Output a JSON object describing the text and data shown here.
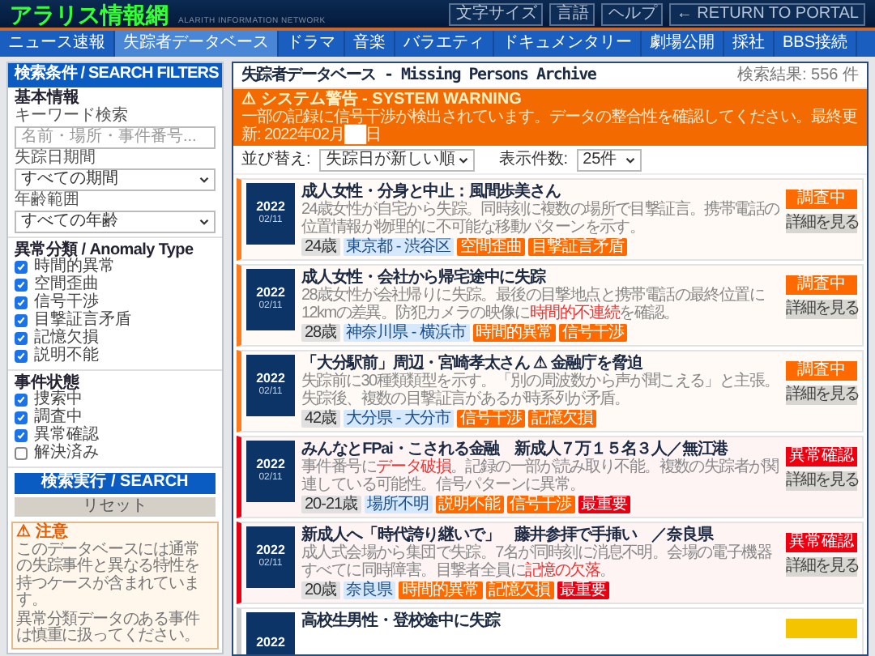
{
  "header": {
    "logo": "アラリス情報網",
    "subtitle": "ALARITH INFORMATION NETWORK",
    "buttons": [
      "文字サイズ",
      "言語",
      "ヘルプ",
      "← RETURN TO PORTAL"
    ]
  },
  "nav": [
    {
      "label": "ニュース速報",
      "selected": false
    },
    {
      "label": "失踪者データベース",
      "selected": true
    },
    {
      "label": "ドラマ",
      "selected": false
    },
    {
      "label": "音楽",
      "selected": false
    },
    {
      "label": "バラエティ",
      "selected": false
    },
    {
      "label": "ドキュメンタリー",
      "selected": false
    },
    {
      "label": "劇場公開",
      "selected": false
    },
    {
      "label": "採社",
      "selected": false
    },
    {
      "label": "BBS接続",
      "selected": false
    }
  ],
  "sidebar": {
    "title": "検索条件 / SEARCH FILTERS",
    "basic_title": "基本情報",
    "keyword_label": "キーワード検索",
    "keyword_placeholder": "名前・場所・事件番号...",
    "period_label": "失踪日期間",
    "period_value": "すべての期間",
    "age_label": "年齢範囲",
    "age_value": "すべての年齢",
    "anomaly_title": "異常分類 / Anomaly Type",
    "anomaly_types": [
      {
        "label": "時間的異常",
        "checked": true
      },
      {
        "label": "空間歪曲",
        "checked": true
      },
      {
        "label": "信号干渉",
        "checked": true
      },
      {
        "label": "目撃証言矛盾",
        "checked": true
      },
      {
        "label": "記憶欠損",
        "checked": true
      },
      {
        "label": "説明不能",
        "checked": true
      }
    ],
    "status_title": "事件状態",
    "statuses": [
      {
        "label": "捜索中",
        "checked": true
      },
      {
        "label": "調査中",
        "checked": true
      },
      {
        "label": "異常確認",
        "checked": true
      },
      {
        "label": "解決済み",
        "checked": false
      }
    ],
    "search_button": "検索実行 / SEARCH",
    "reset_button": "リセット",
    "notice": {
      "title": "⚠ 注意",
      "lines": [
        "このデータベースには通常の失踪事件と異なる特性を持つケースが含まれています。",
        "異常分類データのある事件は慎重に扱ってください。"
      ]
    }
  },
  "main": {
    "title": "失踪者データベース - Missing Persons Archive",
    "result_count": "検索結果: 556 件",
    "warning": {
      "title": "⚠ システム警告 - SYSTEM WARNING",
      "text": "一部の記録に信号干渉が検出されています。データの整合性を確認してください。最終更新: 2022年02月",
      "redacted": "██",
      "suffix": "日"
    },
    "sort_label": "並び替え:",
    "sort_value": "失踪日が新しい順",
    "count_label": "表示件数:",
    "count_value": "25件",
    "cases": [
      {
        "kind": "investigating",
        "year": "2022",
        "date": "02/11",
        "title": "成人女性・分身と中止：風間歩美さん",
        "description": [
          {
            "text": "24歳女性が自宅から失踪。同時刻に複数の場所で目撃証言。携帯電話の位置情報が物理的に不可能な移動パターンを示す。",
            "highlight": false
          }
        ],
        "tags": [
          {
            "kind": "age",
            "text": "24歳"
          },
          {
            "kind": "place",
            "text": "東京都 - 渋谷区"
          },
          {
            "kind": "anomaly",
            "text": "空間歪曲"
          },
          {
            "kind": "anomaly",
            "text": "目撃証言矛盾"
          }
        ],
        "status": "調査中",
        "details": "詳細を見る"
      },
      {
        "kind": "investigating",
        "year": "2022",
        "date": "02/11",
        "title": "成人女性・会社から帰宅途中に失踪",
        "description": [
          {
            "text": "28歳女性が会社帰りに失踪。最後の目撃地点と携帯電話の最終位置に12kmの差異。防犯カメラの映像に",
            "highlight": false
          },
          {
            "text": "時間的不連続",
            "highlight": true
          },
          {
            "text": "を確認。",
            "highlight": false
          }
        ],
        "tags": [
          {
            "kind": "age",
            "text": "28歳"
          },
          {
            "kind": "place",
            "text": "神奈川県 - 横浜市"
          },
          {
            "kind": "anomaly",
            "text": "時間的異常"
          },
          {
            "kind": "anomaly",
            "text": "信号干渉"
          }
        ],
        "status": "調査中",
        "details": "詳細を見る"
      },
      {
        "kind": "investigating",
        "year": "2022",
        "date": "02/11",
        "title": "「大分駅前」周辺・宮崎孝太さん ⚠ 金融庁を脅迫",
        "description": [
          {
            "text": "失踪前に30種類類型を示す。「別の周波数から声が聞こえる」と主張。失踪後、複数の目撃証言があるが時系列が矛盾。",
            "highlight": false
          }
        ],
        "tags": [
          {
            "kind": "age",
            "text": "42歳"
          },
          {
            "kind": "place",
            "text": "大分県 - 大分市"
          },
          {
            "kind": "anomaly",
            "text": "信号干渉"
          },
          {
            "kind": "anomaly",
            "text": "記憶欠損"
          }
        ],
        "status": "調査中",
        "details": "詳細を見る"
      },
      {
        "kind": "anomaly",
        "year": "2022",
        "date": "02/11",
        "title": "みんなとFPai・こされる金融　新成人７万１５名３人／無江港",
        "description": [
          {
            "text": "事件番号に",
            "highlight": false
          },
          {
            "text": "データ破損",
            "highlight": true
          },
          {
            "text": "。記録の一部が読み取り不能。複数の失踪者が関連している可能性。信号パターンに異常。",
            "highlight": false
          }
        ],
        "tags": [
          {
            "kind": "age",
            "text": "20-21歳"
          },
          {
            "kind": "place",
            "text": "場所不明"
          },
          {
            "kind": "anomaly",
            "text": "説明不能"
          },
          {
            "kind": "anomaly",
            "text": "信号干渉"
          },
          {
            "kind": "critical",
            "text": "最重要"
          }
        ],
        "status": "異常確認",
        "details": "詳細を見る"
      },
      {
        "kind": "anomaly",
        "year": "2022",
        "date": "02/11",
        "title": "新成人へ「時代誇り継いで」　藤井参拝で手挿い　／奈良県",
        "description": [
          {
            "text": "成人式会場から集団で失踪。7名が同時刻に消息不明。会場の電子機器すべてに同時障害。目撃者全員に",
            "highlight": false
          },
          {
            "text": "記憶の欠落",
            "highlight": true
          },
          {
            "text": "。",
            "highlight": false
          }
        ],
        "tags": [
          {
            "kind": "age",
            "text": "20歳"
          },
          {
            "kind": "place",
            "text": "奈良県"
          },
          {
            "kind": "anomaly",
            "text": "時間的異常"
          },
          {
            "kind": "anomaly",
            "text": "記憶欠損"
          },
          {
            "kind": "critical",
            "text": "最重要"
          }
        ],
        "status": "異常確認",
        "details": "詳細を見る"
      },
      {
        "kind": "pending",
        "year": "2022",
        "title": "高校生男性・登校途中に失踪"
      }
    ]
  }
}
